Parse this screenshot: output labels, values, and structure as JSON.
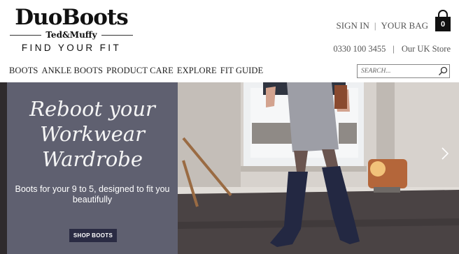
{
  "brand": {
    "name": "DuoBoots",
    "sub": "Ted&Muffy",
    "tagline": "FIND YOUR FIT"
  },
  "account": {
    "sign_in": "SIGN IN",
    "separator": "|",
    "your_bag": "YOUR BAG",
    "bag_count": "0"
  },
  "contact": {
    "phone": "0330 100 3455",
    "separator": "|",
    "store": "Our UK Store"
  },
  "nav": {
    "items": [
      {
        "label": "BOOTS"
      },
      {
        "label": "ANKLE BOOTS"
      },
      {
        "label": "PRODUCT CARE"
      },
      {
        "label": "EXPLORE"
      },
      {
        "label": "FIT GUIDE"
      }
    ]
  },
  "search": {
    "placeholder": "SEARCH...",
    "icon": "search-icon"
  },
  "hero": {
    "title": "Reboot your Workwear Wardrobe",
    "subtitle": "Boots for your 9 to 5, designed to fit you beautifully",
    "cta": "SHOP BOOTS",
    "next_icon": "chevron-right-icon"
  },
  "colors": {
    "panel": "#5f6070",
    "button": "#2a2b43",
    "text": "#222222"
  }
}
